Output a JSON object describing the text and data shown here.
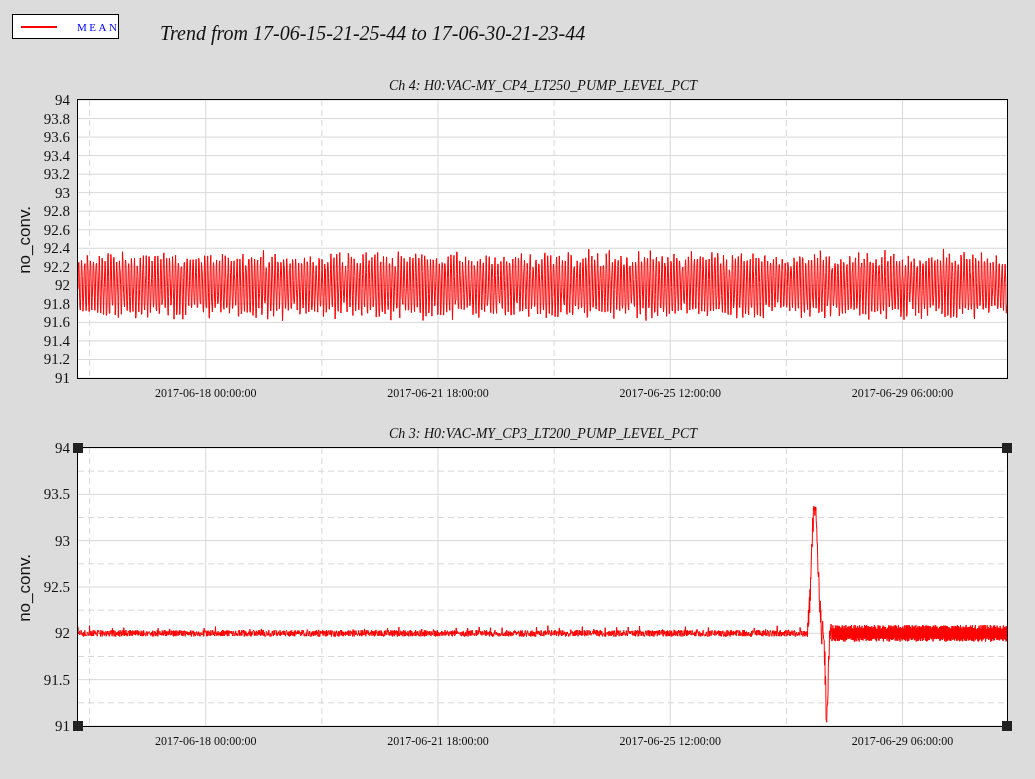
{
  "legend": {
    "items": [
      {
        "label": "MEAN",
        "color": "#ff0000"
      }
    ]
  },
  "title": "Trend from 17-06-15-21-25-44 to 17-06-30-21-23-44",
  "plots": [
    {
      "title": "Ch 4: H0:VAC-MY_CP4_LT250_PUMP_LEVEL_PCT",
      "ylabel": "no_conv.",
      "selected": false,
      "kind": "oscillating",
      "yticks": [
        "94",
        "93.8",
        "93.6",
        "93.4",
        "93.2",
        "93",
        "92.8",
        "92.6",
        "92.4",
        "92.2",
        "92",
        "91.8",
        "91.6",
        "91.4",
        "91.2",
        "91"
      ],
      "xticks": [
        "2017-06-18 00:00:00",
        "2017-06-21 18:00:00",
        "2017-06-25 12:00:00",
        "2017-06-29 06:00:00"
      ]
    },
    {
      "title": "Ch 3: H0:VAC-MY_CP3_LT200_PUMP_LEVEL_PCT",
      "ylabel": "no_conv.",
      "selected": true,
      "kind": "spike",
      "yticks": [
        "94",
        "93.5",
        "93",
        "92.5",
        "92",
        "91.5",
        "91"
      ],
      "xticks": [
        "2017-06-18 00:00:00",
        "2017-06-21 18:00:00",
        "2017-06-25 12:00:00",
        "2017-06-29 06:00:00"
      ]
    }
  ]
}
